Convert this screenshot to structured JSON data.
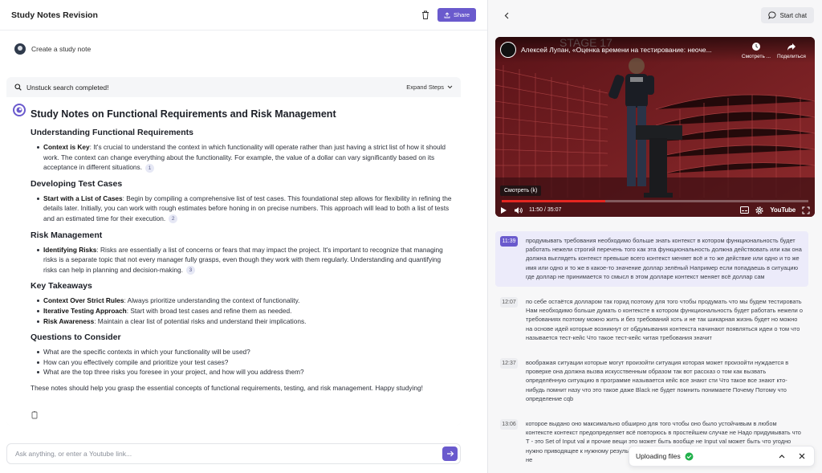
{
  "header": {
    "title": "Study Notes Revision",
    "share_label": "Share"
  },
  "create_note": {
    "label": "Create a study note"
  },
  "panel": {
    "status": "Unstuck search completed!",
    "expand_label": "Expand Steps"
  },
  "notes": {
    "title": "Study Notes on Functional Requirements and Risk Management",
    "sections": [
      {
        "heading": "Understanding Functional Requirements",
        "items": [
          {
            "term": "Context is Key",
            "text": ": It's crucial to understand the context in which functionality will operate rather than just having a strict list of how it should work. The context can change everything about the functionality. For example, the value of a dollar can vary significantly based on its acceptance in different situations.",
            "cite": "1"
          }
        ]
      },
      {
        "heading": "Developing Test Cases",
        "items": [
          {
            "term": "Start with a List of Cases",
            "text": ": Begin by compiling a comprehensive list of test cases. This foundational step allows for flexibility in refining the details later. Initially, you can work with rough estimates before honing in on precise numbers. This approach will lead to both a list of tests and an estimated time for their execution.",
            "cite": "2"
          }
        ]
      },
      {
        "heading": "Risk Management",
        "items": [
          {
            "term": "Identifying Risks",
            "text": ": Risks are essentially a list of concerns or fears that may impact the project. It's important to recognize that managing risks is a separate topic that not every manager fully grasps, even though they work with them regularly. Understanding and quantifying risks can help in planning and decision-making.",
            "cite": "3"
          }
        ]
      },
      {
        "heading": "Key Takeaways",
        "items": [
          {
            "term": "Context Over Strict Rules",
            "text": ": Always prioritize understanding the context of functionality.",
            "cite": ""
          },
          {
            "term": "Iterative Testing Approach",
            "text": ": Start with broad test cases and refine them as needed.",
            "cite": ""
          },
          {
            "term": "Risk Awareness",
            "text": ": Maintain a clear list of potential risks and understand their implications.",
            "cite": ""
          }
        ]
      },
      {
        "heading": "Questions to Consider",
        "items": [
          {
            "term": "",
            "text": "What are the specific contexts in which your functionality will be used?",
            "cite": ""
          },
          {
            "term": "",
            "text": "How can you effectively compile and prioritize your test cases?",
            "cite": ""
          },
          {
            "term": "",
            "text": "What are the top three risks you foresee in your project, and how will you address them?",
            "cite": ""
          }
        ]
      }
    ],
    "closing": "These notes should help you grasp the essential concepts of functional requirements, testing, and risk management. Happy studying!"
  },
  "chat": {
    "placeholder": "Ask anything, or enter a Youtube link..."
  },
  "right_header": {
    "start_chat_label": "Start chat"
  },
  "video": {
    "title": "Алексей Лупан, «Оценка времени на тестирование: неоче...",
    "watch_later": "Смотреть ...",
    "share": "Поделиться",
    "watch_badge": "Смотреть (k)",
    "time": "11:50 / 35:07",
    "progress": 0.337,
    "brand": "YouTube"
  },
  "transcript": [
    {
      "time": "11:39",
      "active": true,
      "text": "продумывать требования необходимо больше знать контекст в котором функциональность будет работать нежели строгий перечень того как эта функциональность должна действовать или как она должна выглядеть контекст превыше всего контекст меняет всё и то же действие или одно и то же имя или одно и то же в какое-то значение доллар зелёный Например если попадаешь в ситуацию где доллар не принимается то смысл в этом долларе контекст меняет всё доллар сам"
    },
    {
      "time": "12:07",
      "active": false,
      "text": "по себе остаётся долларом так горид поэтому для того чтобы продумать что мы будем тестировать Нам необходимо больше думать о контексте в котором функциональность будет работать нежели о требованиях поэтому можно жить и без требований хоть и не так шикарная жизнь будет но можно на основе идей которые возникнут от обдумывания контекста начинают появляться идеи о том что называется тест-кейс Что такое тест-кейс читая требования значит"
    },
    {
      "time": "12:37",
      "active": false,
      "text": "воображая ситуации которые могут произойти ситуация которая может произойти нуждается в проверке она должна вызва искусственным образом так вот рассказ о том как вызвать определённую ситуацию в программе называется кейс все знают сти Что такое все знают кто-нибудь помнит назу что это такое даже Black не будет помнить понимаете Почему Потому что определение cqb"
    },
    {
      "time": "13:06",
      "active": false,
      "text": "которое выдано оно максимально обширно для того чтобы оно было устойчивым в любом контексте контекст предопределяет всё повторюсь в простейшем случае не Надо придумывать что Т - это Set of Input val и прочие вещи это может быть вообще не Input val может быть что угодно нужно приводящее к нужному результату в различных ситуаций додумаешься поэтому дл подумать не"
    }
  ],
  "upload": {
    "label": "Uploading files"
  },
  "colors": {
    "accent": "#6a5acd",
    "success": "#22b14c",
    "youtube_red": "#e52620"
  }
}
